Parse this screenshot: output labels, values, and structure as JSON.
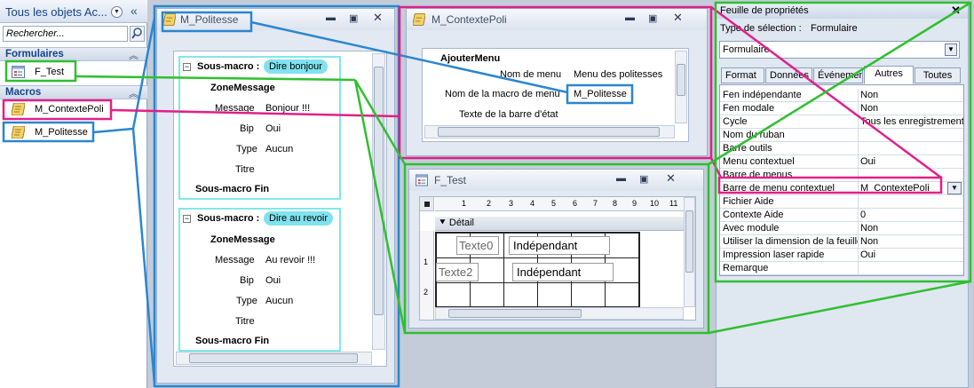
{
  "nav": {
    "title": "Tous les objets Ac...",
    "search_placeholder": "Rechercher...",
    "groups": [
      {
        "label": "Formulaires",
        "items": [
          {
            "label": "F_Test",
            "icon": "form-icon"
          }
        ]
      },
      {
        "label": "Macros",
        "items": [
          {
            "label": "M_ContextePoli",
            "icon": "macro-icon"
          },
          {
            "label": "M_Politesse",
            "icon": "macro-icon"
          }
        ]
      }
    ]
  },
  "politesse": {
    "title": "M_Politesse",
    "blocks": [
      {
        "header": "Sous-macro :",
        "name": "Dire bonjour",
        "action": "ZoneMessage",
        "args": [
          {
            "k": "Message",
            "v": "Bonjour !!!"
          },
          {
            "k": "Bip",
            "v": "Oui"
          },
          {
            "k": "Type",
            "v": "Aucun"
          },
          {
            "k": "Titre",
            "v": ""
          }
        ],
        "end": "Sous-macro Fin"
      },
      {
        "header": "Sous-macro :",
        "name": "Dire au revoir",
        "action": "ZoneMessage",
        "args": [
          {
            "k": "Message",
            "v": "Au revoir !!!"
          },
          {
            "k": "Bip",
            "v": "Oui"
          },
          {
            "k": "Type",
            "v": "Aucun"
          },
          {
            "k": "Titre",
            "v": ""
          }
        ],
        "end": "Sous-macro Fin"
      }
    ]
  },
  "contexte": {
    "title": "M_ContextePoli",
    "action": "AjouterMenu",
    "args": [
      {
        "k": "Nom de menu",
        "v": "Menu des politesses"
      },
      {
        "k": "Nom de la macro de menu",
        "v": "M_Politesse"
      },
      {
        "k": "Texte de la barre d'état",
        "v": ""
      }
    ]
  },
  "ftest": {
    "title": "F_Test",
    "section": "Détail",
    "ruler_digits": [
      "1",
      "2",
      "3",
      "4",
      "5",
      "6",
      "7",
      "8",
      "9",
      "10",
      "11"
    ],
    "vruler_digits": [
      "1",
      "2"
    ],
    "controls": [
      {
        "label": "Texte0",
        "value": "Indépendant"
      },
      {
        "label": "Texte2",
        "value": "Indépendant"
      }
    ]
  },
  "props": {
    "title": "Feuille de propriétés",
    "selection_label": "Type de sélection :",
    "selection_value": "Formulaire",
    "combo_value": "Formulaire",
    "tabs": [
      "Format",
      "Données",
      "Événement",
      "Autres",
      "Toutes"
    ],
    "active_tab": "Autres",
    "rows": [
      {
        "k": "Fen indépendante",
        "v": "Non"
      },
      {
        "k": "Fen modale",
        "v": "Non"
      },
      {
        "k": "Cycle",
        "v": "Tous les enregistrements"
      },
      {
        "k": "Nom du ruban",
        "v": ""
      },
      {
        "k": "Barre outils",
        "v": ""
      },
      {
        "k": "Menu contextuel",
        "v": "Oui"
      },
      {
        "k": "Barre de menus",
        "v": ""
      },
      {
        "k": "Barre de menu contextuel",
        "v": "M_ContextePoli"
      },
      {
        "k": "Fichier Aide",
        "v": ""
      },
      {
        "k": "Contexte Aide",
        "v": "0"
      },
      {
        "k": "Avec module",
        "v": "Non"
      },
      {
        "k": "Utiliser la dimension de la feuille",
        "v": "Non"
      },
      {
        "k": "Impression laser rapide",
        "v": "Oui"
      },
      {
        "k": "Remarque",
        "v": ""
      }
    ]
  },
  "colors": {
    "blue_annotation": "#2b86cf",
    "green_annotation": "#2fbf2f",
    "magenta_annotation": "#e0208a",
    "pill": "#7fe2ee"
  }
}
